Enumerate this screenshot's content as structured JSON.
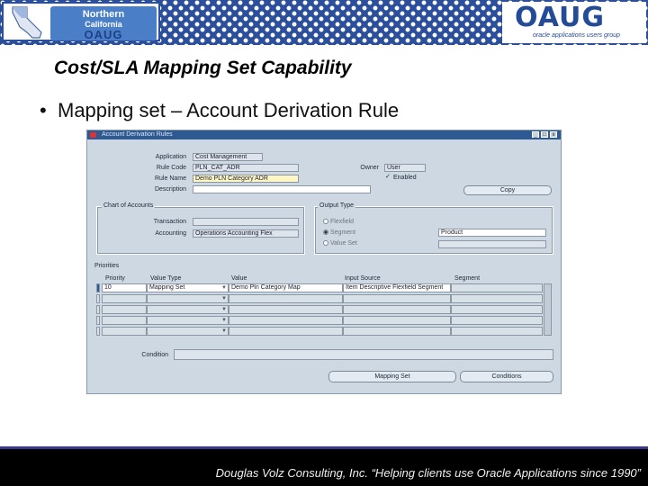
{
  "branding": {
    "left_logo": {
      "line1": "Northern",
      "line2": "California",
      "line3": "OAUG"
    },
    "right_logo": {
      "name": "OAUG",
      "tagline": "oracle applications users group"
    }
  },
  "slide": {
    "title": "Cost/SLA Mapping Set Capability",
    "bullet": "Mapping set – Account Derivation Rule"
  },
  "form": {
    "window_title": "Account Derivation Rules",
    "window_buttons": [
      "_",
      "□",
      "x"
    ],
    "fields": {
      "application": {
        "label": "Application",
        "value": "Cost Management"
      },
      "rule_code": {
        "label": "Rule Code",
        "value": "PLN_CAT_ADR"
      },
      "rule_name": {
        "label": "Rule Name",
        "value": "Demo PLN Category ADR"
      },
      "description": {
        "label": "Description",
        "value": ""
      },
      "owner": {
        "label": "Owner",
        "value": "User"
      },
      "enabled": {
        "label": "Enabled",
        "checked": true
      }
    },
    "copy_button": "Copy",
    "chart_of_accounts": {
      "title": "Chart of Accounts",
      "transaction": {
        "label": "Transaction",
        "value": ""
      },
      "accounting": {
        "label": "Accounting",
        "value": "Operations Accounting Flex"
      }
    },
    "output_type": {
      "title": "Output Type",
      "options": [
        {
          "label": "Flexfield",
          "selected": false
        },
        {
          "label": "Segment",
          "selected": true
        },
        {
          "label": "Value Set",
          "selected": false
        }
      ],
      "segment_value": "Product",
      "value_set_value": ""
    },
    "priorities": {
      "title": "Priorities",
      "headers": [
        "Priority",
        "Value Type",
        "Value",
        "Input Source",
        "Segment"
      ],
      "rows": [
        [
          "10",
          "Mapping Set",
          "Demo Pln Category Map",
          "Item Descriptive Flexfield Segment",
          ""
        ],
        [
          "",
          "",
          "",
          "",
          ""
        ],
        [
          "",
          "",
          "",
          "",
          ""
        ],
        [
          "",
          "",
          "",
          "",
          ""
        ],
        [
          "",
          "",
          "",
          "",
          ""
        ]
      ]
    },
    "condition": {
      "label": "Condition",
      "value": ""
    },
    "buttons": {
      "mapping_set": "Mapping Set",
      "conditions": "Conditions"
    }
  },
  "footer": {
    "text": "Douglas Volz Consulting, Inc. “Helping clients use Oracle Applications since 1990”"
  },
  "colors": {
    "banner_blue": "#2b4f9c",
    "form_bg": "#ced8e2",
    "titlebar": "#2e5a93",
    "footer_bg": "#000000"
  }
}
